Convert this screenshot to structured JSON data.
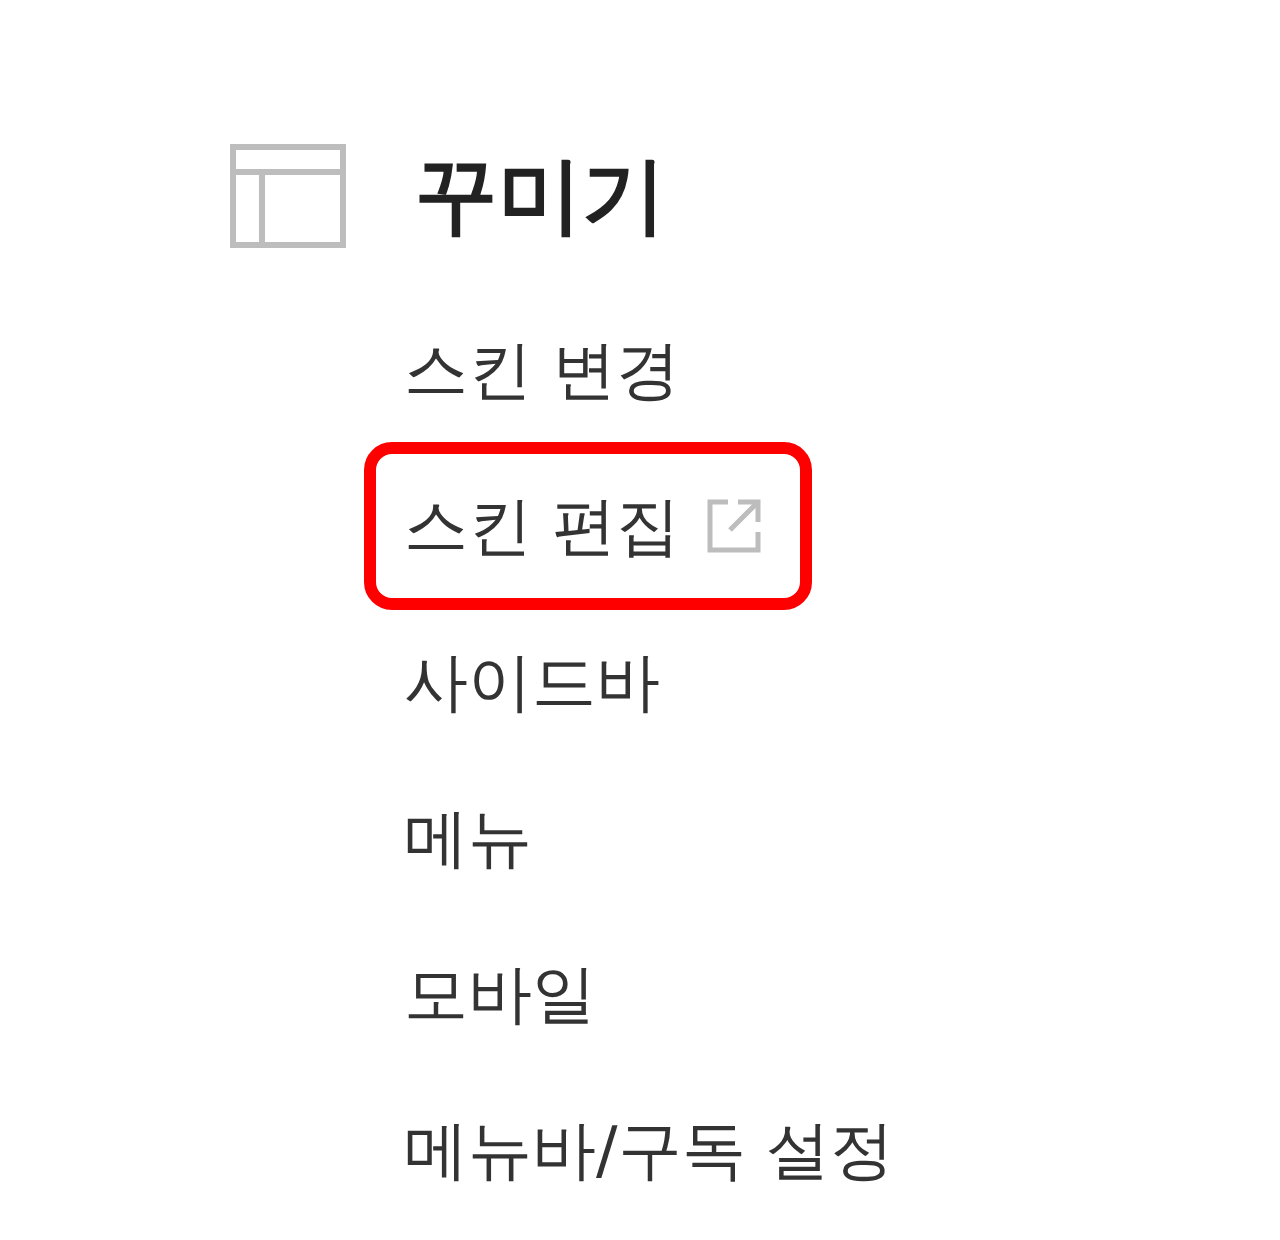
{
  "section": {
    "title": "꾸미기"
  },
  "items": [
    {
      "label": "스킨 변경",
      "external": false,
      "highlighted": false
    },
    {
      "label": "스킨 편집",
      "external": true,
      "highlighted": true
    },
    {
      "label": "사이드바",
      "external": false,
      "highlighted": false
    },
    {
      "label": "메뉴",
      "external": false,
      "highlighted": false
    },
    {
      "label": "모바일",
      "external": false,
      "highlighted": false
    },
    {
      "label": "메뉴바/구독 설정",
      "external": false,
      "highlighted": false
    }
  ]
}
